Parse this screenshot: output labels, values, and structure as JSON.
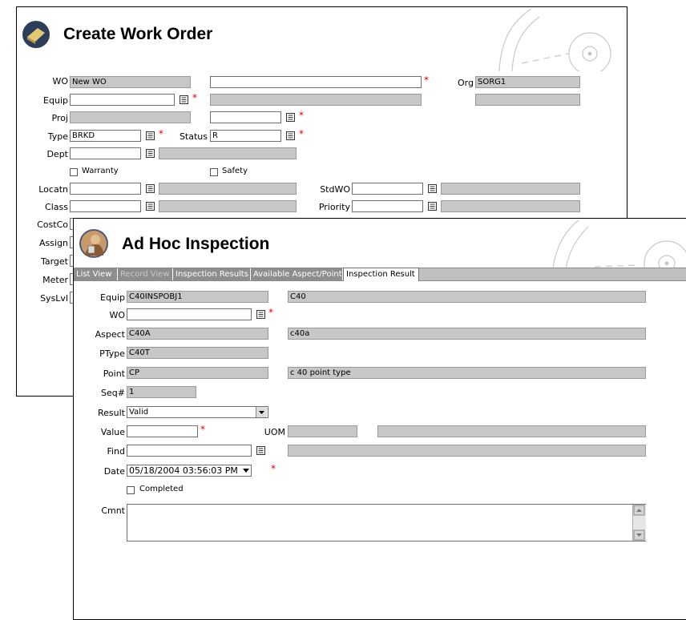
{
  "create_wo": {
    "title": "Create Work Order",
    "labels": {
      "wo": "WO",
      "equip": "Equip",
      "proj": "Proj",
      "type": "Type",
      "status": "Status",
      "dept": "Dept",
      "org": "Org",
      "warranty": "Warranty",
      "safety": "Safety",
      "locatn": "Locatn",
      "class": "Class",
      "costco": "CostCo",
      "assign": "Assign",
      "target": "Target",
      "meter": "Meter",
      "syslvl": "SysLvl",
      "stdwo": "StdWO",
      "priority": "Priority"
    },
    "values": {
      "wo": "New WO",
      "wo_desc": "",
      "org": "SORG1",
      "equip": "",
      "type": "BRKD",
      "status": "R"
    }
  },
  "adhoc": {
    "title": "Ad Hoc Inspection",
    "tabs": [
      "List View",
      "Record View",
      "Inspection Results",
      "Available Aspect/Point",
      "Inspection Result"
    ],
    "labels": {
      "equip": "Equip",
      "wo": "WO",
      "aspect": "Aspect",
      "ptype": "PType",
      "point": "Point",
      "seq": "Seq#",
      "result": "Result",
      "value": "Value",
      "uom": "UOM",
      "find": "Find",
      "date": "Date",
      "completed": "Completed",
      "cmnt": "Cmnt"
    },
    "values": {
      "equip": "C40INSPOBJ1",
      "equip_desc": "C40",
      "wo": "",
      "aspect": "C40A",
      "aspect_desc": "c40a",
      "ptype": "C40T",
      "point": "CP",
      "point_desc": "c 40 point type",
      "seq": "1",
      "result": "Valid",
      "value": "",
      "uom": "",
      "uom_desc": "",
      "find": "",
      "find_desc": "",
      "date": "05/18/2004 03:56:03 PM",
      "cmnt": ""
    }
  },
  "colors": {
    "required": "#e00000",
    "readonly": "#c7c7c7",
    "tab_bg": "#8e8e8e"
  }
}
